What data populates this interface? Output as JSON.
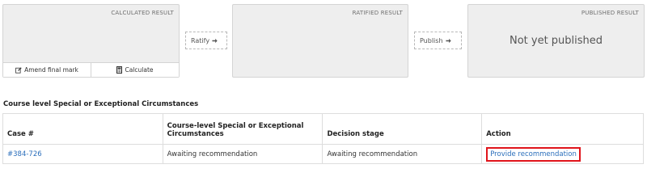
{
  "results": {
    "calculated": {
      "title": "CALCULATED RESULT",
      "amend_label": "Amend final mark",
      "calculate_label": "Calculate"
    },
    "ratify_label": "Ratify",
    "ratified": {
      "title": "RATIFIED RESULT"
    },
    "publish_label": "Publish",
    "published": {
      "title": "PUBLISHED RESULT",
      "status": "Not yet published"
    }
  },
  "circumstances": {
    "heading": "Course level Special or Exceptional Circumstances",
    "columns": [
      "Case #",
      "Course-level Special or Exceptional Circumstances",
      "Decision stage",
      "Action"
    ],
    "rows": [
      {
        "case": "#384-726",
        "circumstances": "Awaiting recommendation",
        "stage": "Awaiting recommendation",
        "action": "Provide recommendation"
      }
    ]
  },
  "colors": {
    "link": "#2a6ebb",
    "highlight": "#e0141b",
    "box_bg": "#eeeeee"
  }
}
